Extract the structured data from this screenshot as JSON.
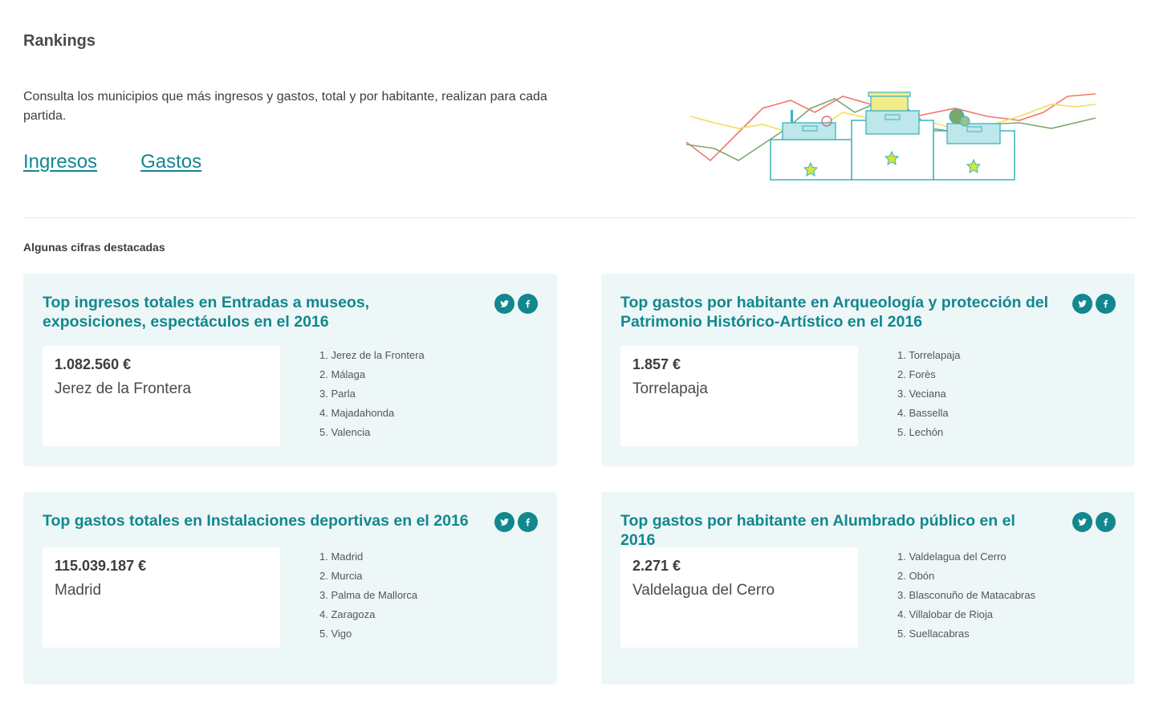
{
  "header": {
    "title": "Rankings",
    "intro": "Consulta los municipios que más ingresos y gastos, total y por habitante, realizan para cada partida.",
    "links": [
      "Ingresos",
      "Gastos"
    ]
  },
  "section": {
    "title": "Algunas cifras destacadas"
  },
  "cards": [
    {
      "title": "Top ingresos totales en Entradas a museos, exposiciones, espectáculos en el 2016",
      "amount": "1.082.560 €",
      "place": "Jerez de la Frontera",
      "ranking": [
        "1. Jerez de la Frontera",
        "2. Málaga",
        "3. Parla",
        "4. Majadahonda",
        "5. Valencia"
      ]
    },
    {
      "title": "Top gastos por habitante en Arqueología y protección del Patrimonio Histórico-Artístico en el 2016",
      "amount": "1.857 €",
      "place": "Torrelapaja",
      "ranking": [
        "1. Torrelapaja",
        "2. Forès",
        "3. Veciana",
        "4. Bassella",
        "5. Lechón"
      ]
    },
    {
      "title": "Top gastos totales en Instalaciones deportivas en el 2016",
      "amount": "115.039.187 €",
      "place": "Madrid",
      "ranking": [
        "1. Madrid",
        "2. Murcia",
        "3. Palma de Mallorca",
        "4. Zaragoza",
        "5. Vigo"
      ]
    },
    {
      "title": "Top gastos por habitante en Alumbrado público en el 2016",
      "amount": "2.271 €",
      "place": "Valdelagua del Cerro",
      "ranking": [
        "1. Valdelagua del Cerro",
        "2. Obón",
        "3. Blasconuño de Matacabras",
        "4. Villalobar de Rioja",
        "5. Suellacabras"
      ]
    }
  ],
  "icons": {
    "share_twitter": "twitter-icon",
    "share_facebook": "facebook-icon"
  },
  "colors": {
    "accent": "#12878f",
    "card_bg": "#eef7f7"
  }
}
